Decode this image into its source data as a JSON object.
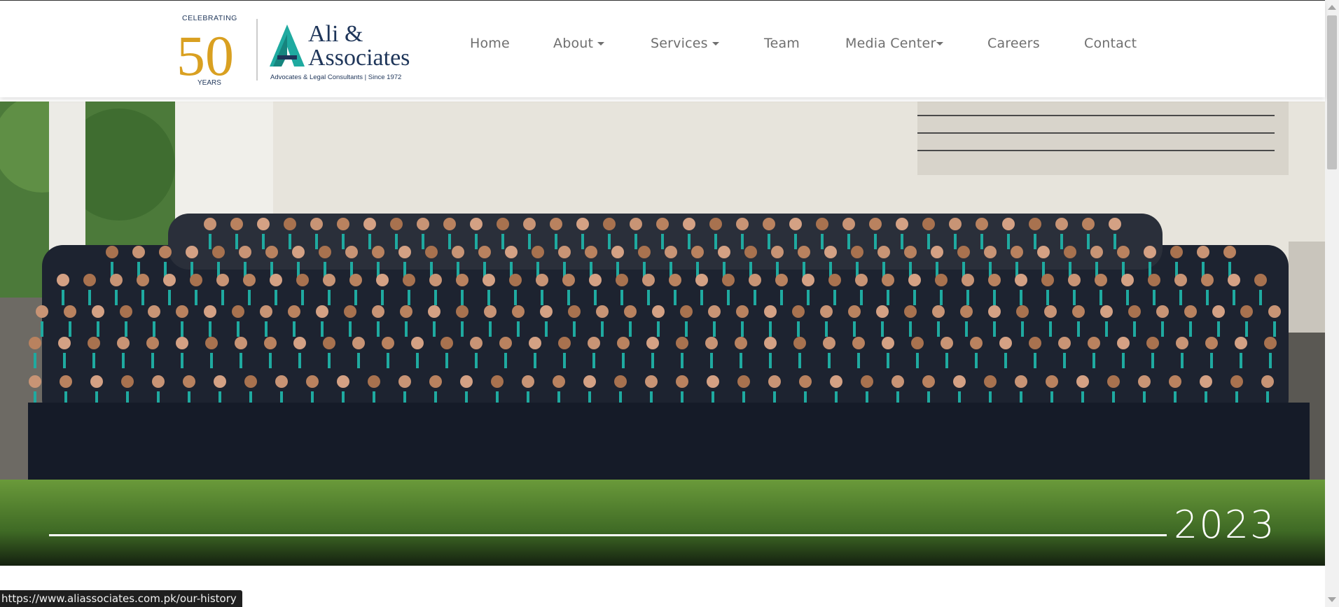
{
  "logo": {
    "celebrating": "CELEBRATING",
    "number": "50",
    "years": "YEARS",
    "name_line1": "Ali &",
    "name_line2": "Associates",
    "tagline": "Advocates & Legal Consultants | Since 1972"
  },
  "nav": {
    "home": "Home",
    "about": "About",
    "services": "Services",
    "team": "Team",
    "media_center": "Media Center",
    "careers": "Careers",
    "contact": "Contact"
  },
  "hero": {
    "year": "2023"
  },
  "status": {
    "url": "https://www.aliassociates.com.pk/our-history"
  },
  "colors": {
    "teal": "#1faaa0",
    "navy": "#1e3559",
    "gold": "#d9a021",
    "nav_text": "#6f6f6f",
    "grass": "#4d7a2d"
  }
}
